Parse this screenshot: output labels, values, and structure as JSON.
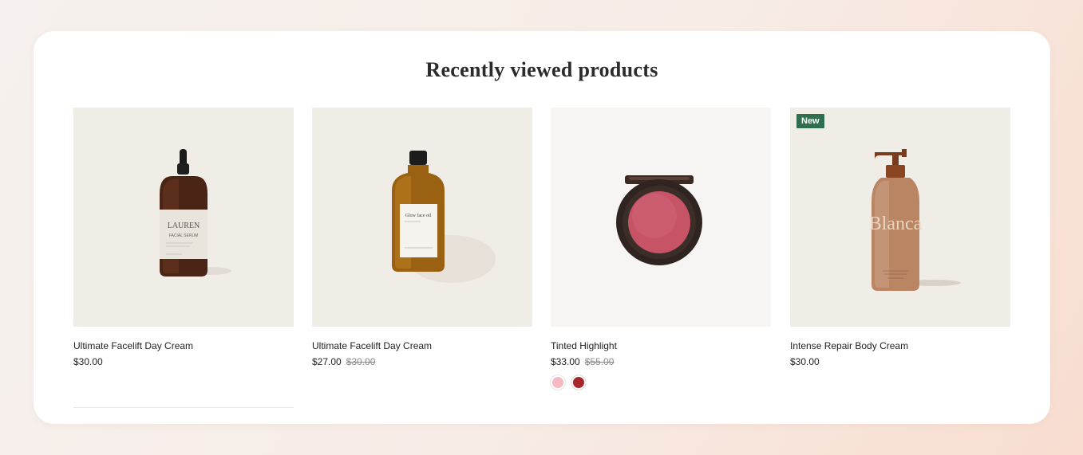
{
  "section": {
    "title": "Recently viewed products"
  },
  "products": [
    {
      "name": "Ultimate Facelift Day Cream",
      "price": "$30.00",
      "label_brand": "LAUREN",
      "label_line": "FACIAL SERUM",
      "icon": "dropper-serum-bottle"
    },
    {
      "name": "Ultimate Facelift Day Cream",
      "price": "$27.00",
      "compare_price": "$30.00",
      "label_line": "Glow face oil",
      "icon": "face-oil-bottle"
    },
    {
      "name": "Tinted Highlight",
      "price": "$33.00",
      "compare_price": "$55.00",
      "icon": "blush-compact",
      "swatches": [
        {
          "label": "Pink",
          "color": "#f5b9c4"
        },
        {
          "label": "Red",
          "color": "#a7282c"
        }
      ]
    },
    {
      "name": "Intense Repair Body Cream",
      "price": "$30.00",
      "badge": "New",
      "label_brand": "Blanca",
      "icon": "pump-bottle"
    }
  ],
  "colors": {
    "badge_bg": "#2f6e4e",
    "image_bg_warm": "#f0ece6",
    "image_bg_light": "#f6f5f3"
  }
}
